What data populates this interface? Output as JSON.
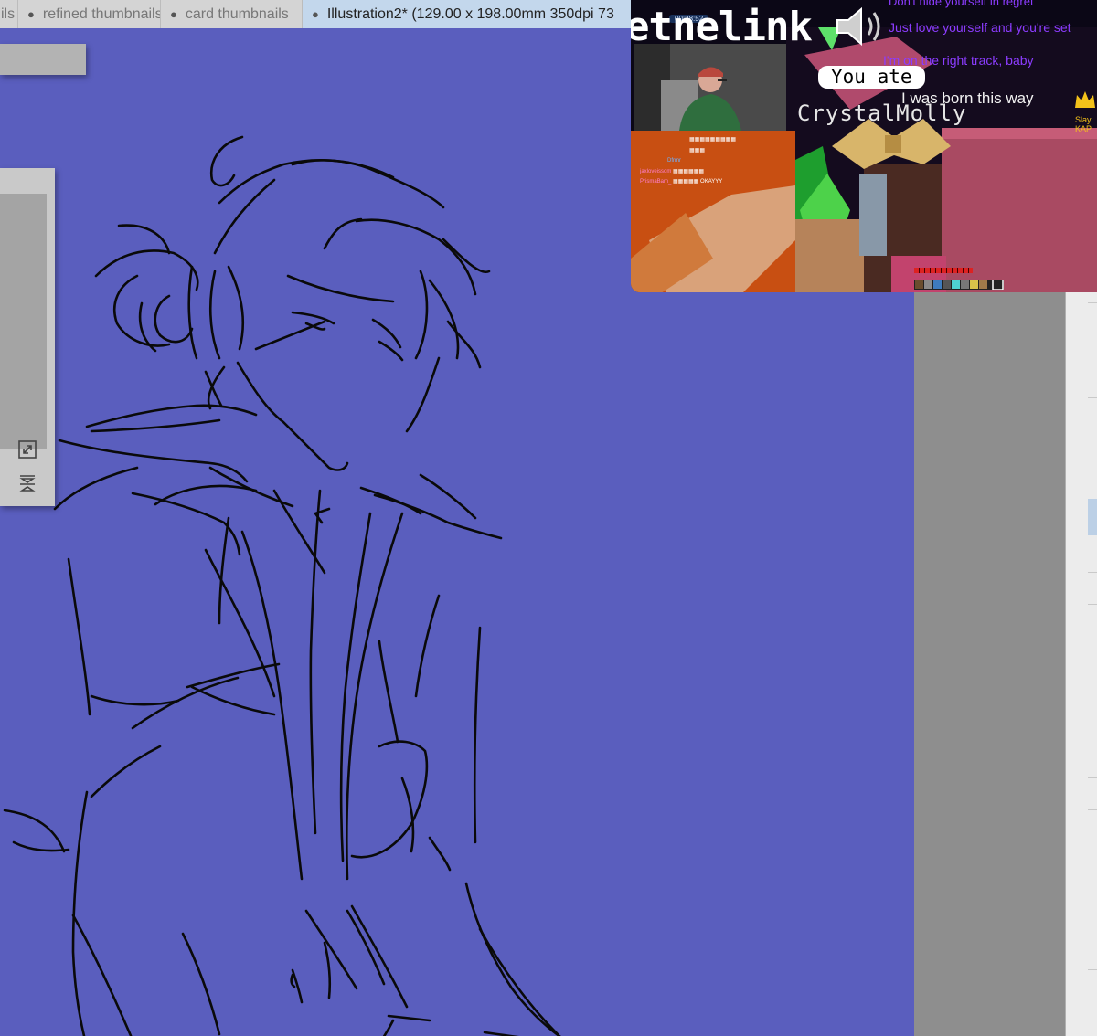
{
  "tabs": [
    {
      "label": "ils",
      "active": false
    },
    {
      "label": "refined thumbnails",
      "active": false
    },
    {
      "label": "card thumbnails",
      "active": false
    },
    {
      "label": "Illustration2* (129.00 x 198.00mm 350dpi 73",
      "active": true
    }
  ],
  "tab_dot": "●",
  "canvas": {
    "background": "#595ebc"
  },
  "stream": {
    "top_counter": "00:38:52",
    "logo_text": "etnelink",
    "lyrics": [
      "Don't hide yourself in regret",
      "Just love yourself and you're set",
      "I'm on the right track, baby",
      "I was born this way"
    ],
    "popup_text": "You ate",
    "username": "CrystalMolly",
    "badge_text": "Slay KAP",
    "chat": [
      {
        "user": "Dfrmr",
        "message": ""
      },
      {
        "user": "jaxloveissom",
        "message": ""
      },
      {
        "user": "PrismaBam_",
        "message": "OKAYYY"
      }
    ]
  }
}
